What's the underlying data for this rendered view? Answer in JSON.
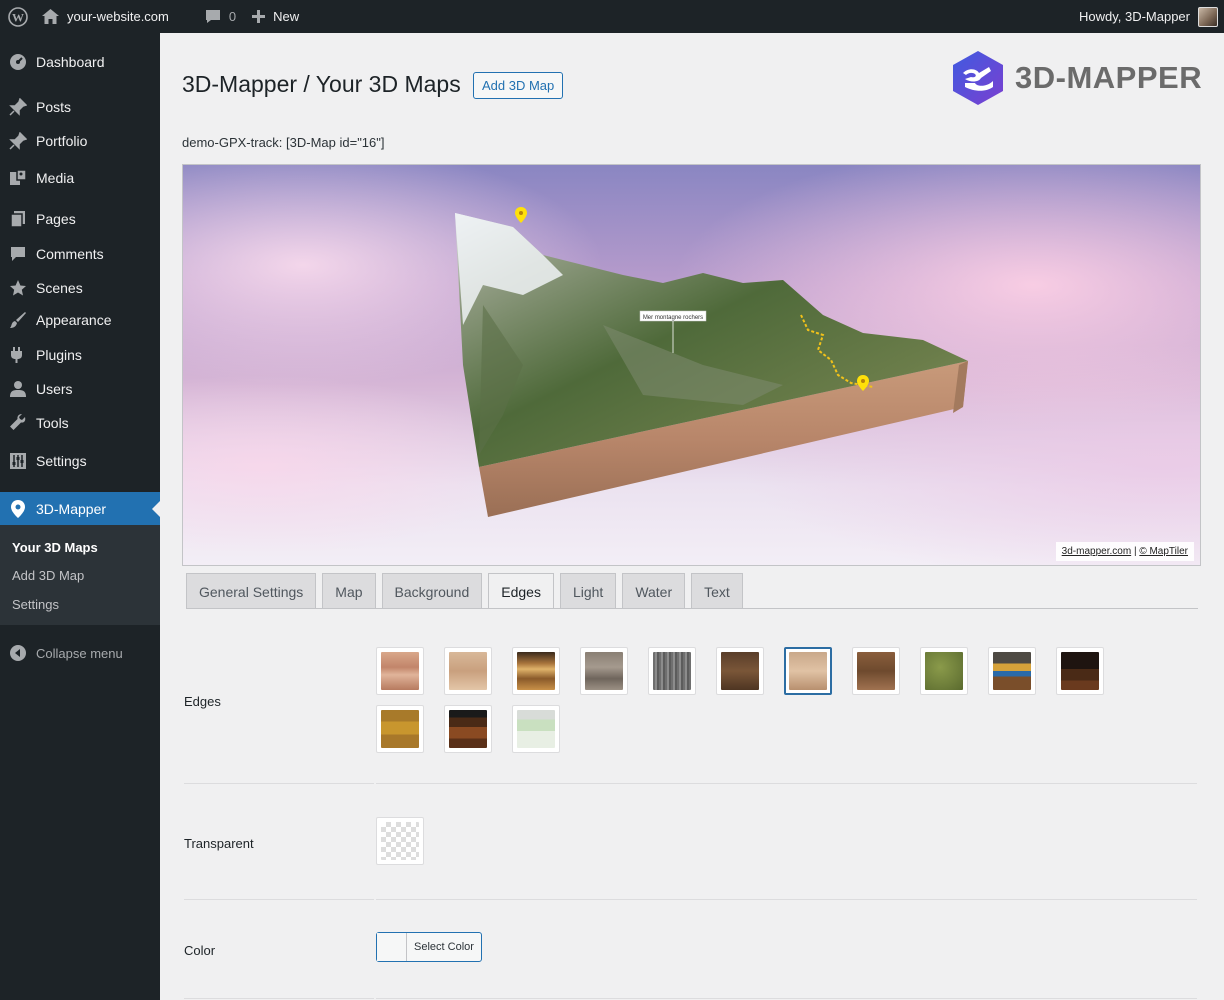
{
  "adminbar": {
    "site_name": "your-website.com",
    "comments_count": "0",
    "new_label": "New",
    "greeting": "Howdy, 3D-Mapper"
  },
  "sidebar": {
    "items": [
      {
        "label": "Dashboard",
        "icon": "dashboard-icon"
      },
      {
        "label": "Posts",
        "icon": "pin-icon"
      },
      {
        "label": "Portfolio",
        "icon": "pin-icon"
      },
      {
        "label": "Media",
        "icon": "media-icon"
      },
      {
        "label": "Pages",
        "icon": "pages-icon"
      },
      {
        "label": "Comments",
        "icon": "comment-icon"
      },
      {
        "label": "Scenes",
        "icon": "star-icon"
      },
      {
        "label": "Appearance",
        "icon": "brush-icon"
      },
      {
        "label": "Plugins",
        "icon": "plug-icon"
      },
      {
        "label": "Users",
        "icon": "user-icon"
      },
      {
        "label": "Tools",
        "icon": "wrench-icon"
      },
      {
        "label": "Settings",
        "icon": "settings-icon"
      },
      {
        "label": "3D-Mapper",
        "icon": "location-icon"
      }
    ],
    "submenu": [
      "Your 3D Maps",
      "Add 3D Map",
      "Settings"
    ],
    "collapse_label": "Collapse menu"
  },
  "header": {
    "title": "3D-Mapper / Your 3D Maps",
    "add_button": "Add 3D Map",
    "logo_text": "3D-MAPPER"
  },
  "map": {
    "shortcode": "demo-GPX-track: [3D-Map id=\"16\"]",
    "attribution_site": "3d-mapper.com",
    "attribution_sep": "|",
    "attribution_tiles": "© MapTiler",
    "label": "Mer montagne rochers"
  },
  "tabs": [
    "General Settings",
    "Map",
    "Background",
    "Edges",
    "Light",
    "Water",
    "Text"
  ],
  "active_tab": "Edges",
  "edges": {
    "label": "Edges",
    "selected_index": 6
  },
  "transparent": {
    "label": "Transparent"
  },
  "color": {
    "label": "Color",
    "button": "Select Color"
  },
  "colors": {
    "accent": "#2271b1",
    "sidebar_bg": "#1d2327",
    "submenu_bg": "#2c3338",
    "page_bg": "#f0f0f1"
  }
}
